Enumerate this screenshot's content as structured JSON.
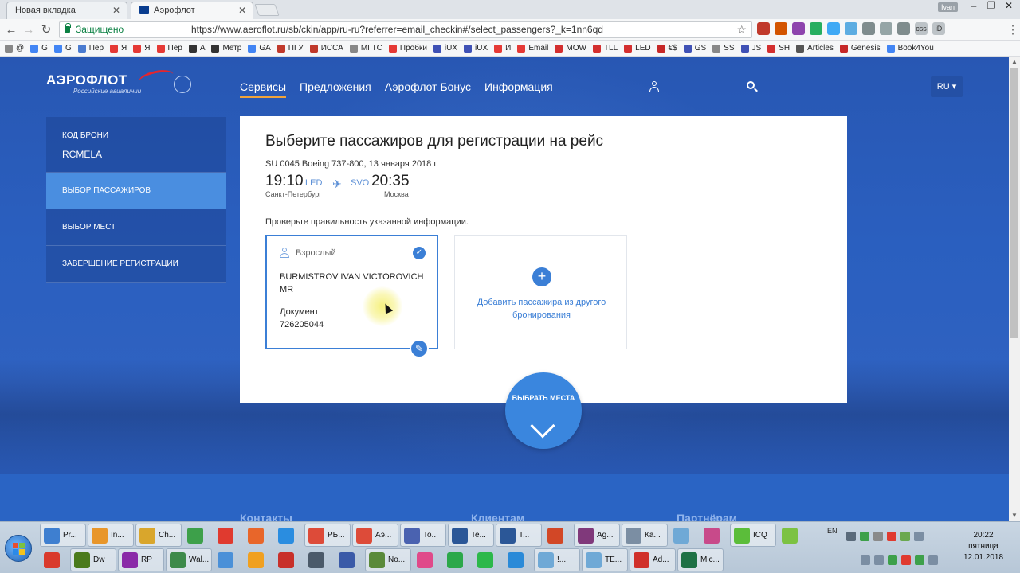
{
  "browser": {
    "tabs": [
      {
        "title": "Новая вкладка",
        "active": false
      },
      {
        "title": "Аэрофлот",
        "active": true
      }
    ],
    "user_chip": "Ivan",
    "secure_label": "Защищено",
    "url": "https://www.aeroflot.ru/sb/ckin/app/ru-ru?referrer=email_checkin#/select_passengers?_k=1nn6qd",
    "bookmarks": [
      "@",
      "G",
      "G",
      "Пер",
      "Я",
      "Я",
      "Пер",
      "A",
      "Метр",
      "GA",
      "ПГУ",
      "ИССА",
      "МГТС",
      "Пробки",
      "iUX",
      "iUX",
      "И",
      "Email",
      "MOW",
      "TLL",
      "LED",
      "€$",
      "GS",
      "SS",
      "JS",
      "SH",
      "Articles",
      "Genesis",
      "Book4You"
    ]
  },
  "site": {
    "logo_word": "АЭРОФЛОТ",
    "logo_sub": "Российские авиалинии",
    "nav": [
      "Сервисы",
      "Предложения",
      "Аэрофлот Бонус",
      "Информация"
    ],
    "lang": "RU ▾"
  },
  "sidebar": {
    "code_label": "КОД БРОНИ",
    "code_value": "RCMELA",
    "steps": [
      "ВЫБОР ПАССАЖИРОВ",
      "ВЫБОР МЕСТ",
      "ЗАВЕРШЕНИЕ РЕГИСТРАЦИИ"
    ],
    "active_step": 0
  },
  "card": {
    "title": "Выберите пассажиров для регистрации на рейс",
    "flight_line": "SU 0045 Boeing 737-800, 13 января 2018 г.",
    "dep_time": "19:10",
    "dep_code": "LED",
    "dep_city": "Санкт-Петербург",
    "arr_code": "SVO",
    "arr_time": "20:35",
    "arr_city": "Москва",
    "check_info": "Проверьте правильность указанной информации.",
    "passenger": {
      "type": "Взрослый",
      "name": "BURMISTROV IVAN VICTOROVICH MR",
      "doc_label": "Документ",
      "doc_number": "726205044"
    },
    "add_passenger": "Добавить пассажира из другого бронирования",
    "seats_button": "ВЫБРАТЬ МЕСТА"
  },
  "footer": {
    "links": [
      "Контакты",
      "Клиентам",
      "Партнёрам"
    ]
  },
  "taskbar": {
    "row1": [
      {
        "label": "Pr...",
        "color": "#3e7fd0"
      },
      {
        "label": "In...",
        "color": "#e8962a"
      },
      {
        "label": "Ch...",
        "color": "#d9a62c"
      },
      {
        "label": "",
        "color": "#3da04a"
      },
      {
        "label": "",
        "color": "#e03a2f"
      },
      {
        "label": "",
        "color": "#e8662a"
      },
      {
        "label": "",
        "color": "#2a8de0"
      },
      {
        "label": "РБ...",
        "color": "#dd4b39"
      },
      {
        "label": "Аэ...",
        "color": "#dd4b39"
      },
      {
        "label": "To...",
        "color": "#4a62b0"
      },
      {
        "label": "Te...",
        "color": "#2b5797"
      },
      {
        "label": "T...",
        "color": "#2b5797"
      },
      {
        "label": "",
        "color": "#d24726"
      },
      {
        "label": "Ag...",
        "color": "#80397b"
      },
      {
        "label": "Ка...",
        "color": "#7b8ea3"
      },
      {
        "label": "",
        "color": "#6fa9d6"
      },
      {
        "label": "",
        "color": "#c84a8a"
      },
      {
        "label": "ICQ",
        "color": "#5bbd3a"
      },
      {
        "label": "",
        "color": "#7cc242"
      }
    ],
    "row2": [
      {
        "label": "",
        "color": "#d93a2c"
      },
      {
        "label": "Dw",
        "color": "#4a7a1c"
      },
      {
        "label": "RP",
        "color": "#8a2aa8"
      },
      {
        "label": "Wal...",
        "color": "#3d8a4a"
      },
      {
        "label": "",
        "color": "#4a90d8"
      },
      {
        "label": "",
        "color": "#f0a020"
      },
      {
        "label": "",
        "color": "#c8302a"
      },
      {
        "label": "",
        "color": "#4b5a6a"
      },
      {
        "label": "",
        "color": "#3a5aa8"
      },
      {
        "label": "No...",
        "color": "#5a8a3a"
      },
      {
        "label": "",
        "color": "#e04a8a"
      },
      {
        "label": "",
        "color": "#2ca84a"
      },
      {
        "label": "",
        "color": "#2cb84a"
      },
      {
        "label": "",
        "color": "#2a8ad8"
      },
      {
        "label": "!...",
        "color": "#6fa9d6"
      },
      {
        "label": "TE...",
        "color": "#6fa9d6"
      },
      {
        "label": "Ad...",
        "color": "#d0302a"
      },
      {
        "label": "Mic...",
        "color": "#1e7145"
      }
    ],
    "tray_lang": "EN",
    "clock_time": "20:22",
    "clock_day": "пятница",
    "clock_date": "12.01.2018"
  }
}
